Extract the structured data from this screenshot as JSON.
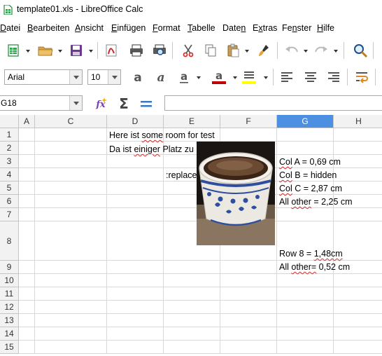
{
  "window": {
    "title": "template01.xls - LibreOffice Calc"
  },
  "menu": [
    {
      "pre": "",
      "ul": "D",
      "post": "atei"
    },
    {
      "pre": "",
      "ul": "B",
      "post": "earbeiten"
    },
    {
      "pre": "",
      "ul": "A",
      "post": "nsicht"
    },
    {
      "pre": "",
      "ul": "E",
      "post": "infügen"
    },
    {
      "pre": "",
      "ul": "F",
      "post": "ormat"
    },
    {
      "pre": "",
      "ul": "T",
      "post": "abelle"
    },
    {
      "pre": "Date",
      "ul": "n",
      "post": ""
    },
    {
      "pre": "E",
      "ul": "x",
      "post": "tras"
    },
    {
      "pre": "Fe",
      "ul": "n",
      "post": "ster"
    },
    {
      "pre": "",
      "ul": "H",
      "post": "ilfe"
    }
  ],
  "formatting": {
    "font_name": "Arial",
    "font_size": "10",
    "font_color": "#c00000",
    "highlight_color": "#ffff00"
  },
  "formula_bar": {
    "name_box": "G18",
    "formula": ""
  },
  "columns": [
    "A",
    "C",
    "D",
    "E",
    "F",
    "G",
    "H"
  ],
  "selected_column": "G",
  "rows": [
    "1",
    "2",
    "3",
    "4",
    "5",
    "6",
    "7",
    "8",
    "9",
    "10",
    "11",
    "12",
    "13",
    "14",
    "15"
  ],
  "cells": {
    "d1": "Here ist some room for test",
    "d2": "Da ist einiger Platz zu",
    "e4": ":replace",
    "g3": "Col A = 0,69 cm",
    "g4": "Col B = hidden",
    "g5": "Col C = 2,87 cm",
    "g6": "All other = 2,25 cm",
    "g8": "Row 8 = 1,48cm",
    "g9": "All other= 0,52 cm"
  },
  "image": {
    "description": "coffee-cup-photo"
  }
}
